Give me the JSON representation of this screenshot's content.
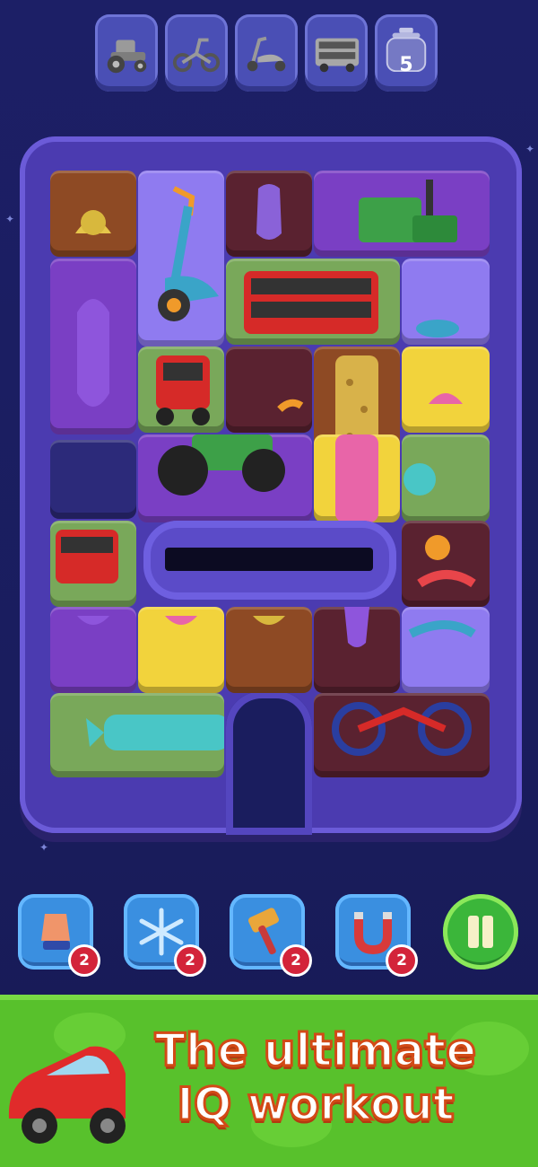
{
  "goals": {
    "items": [
      {
        "icon": "tractor-icon",
        "label": "tractor"
      },
      {
        "icon": "tricycle-icon",
        "label": "tricycle"
      },
      {
        "icon": "scooter-icon",
        "label": "scooter"
      },
      {
        "icon": "bus-icon",
        "label": "bus"
      },
      {
        "icon": "jar-icon",
        "count": "5"
      }
    ]
  },
  "colors": {
    "background": "#1c1f66",
    "frame": "#4b3bb0",
    "brown": "#8e4a24",
    "purple": "#7a3fc4",
    "maroon": "#5a2230",
    "green": "#79a85a",
    "yellow": "#f2d33c",
    "lavender": "#8f7bf0",
    "banner_green": "#58c12c",
    "headline_stroke": "#d24a16"
  },
  "boosters": [
    {
      "icon": "glove-icon",
      "count": "2"
    },
    {
      "icon": "snowflake-icon",
      "count": "2"
    },
    {
      "icon": "hammer-icon",
      "count": "2"
    },
    {
      "icon": "magnet-icon",
      "count": "2"
    }
  ],
  "pause": {
    "icon": "pause-icon"
  },
  "banner": {
    "line1": "The ultimate",
    "line2": "IQ workout"
  }
}
